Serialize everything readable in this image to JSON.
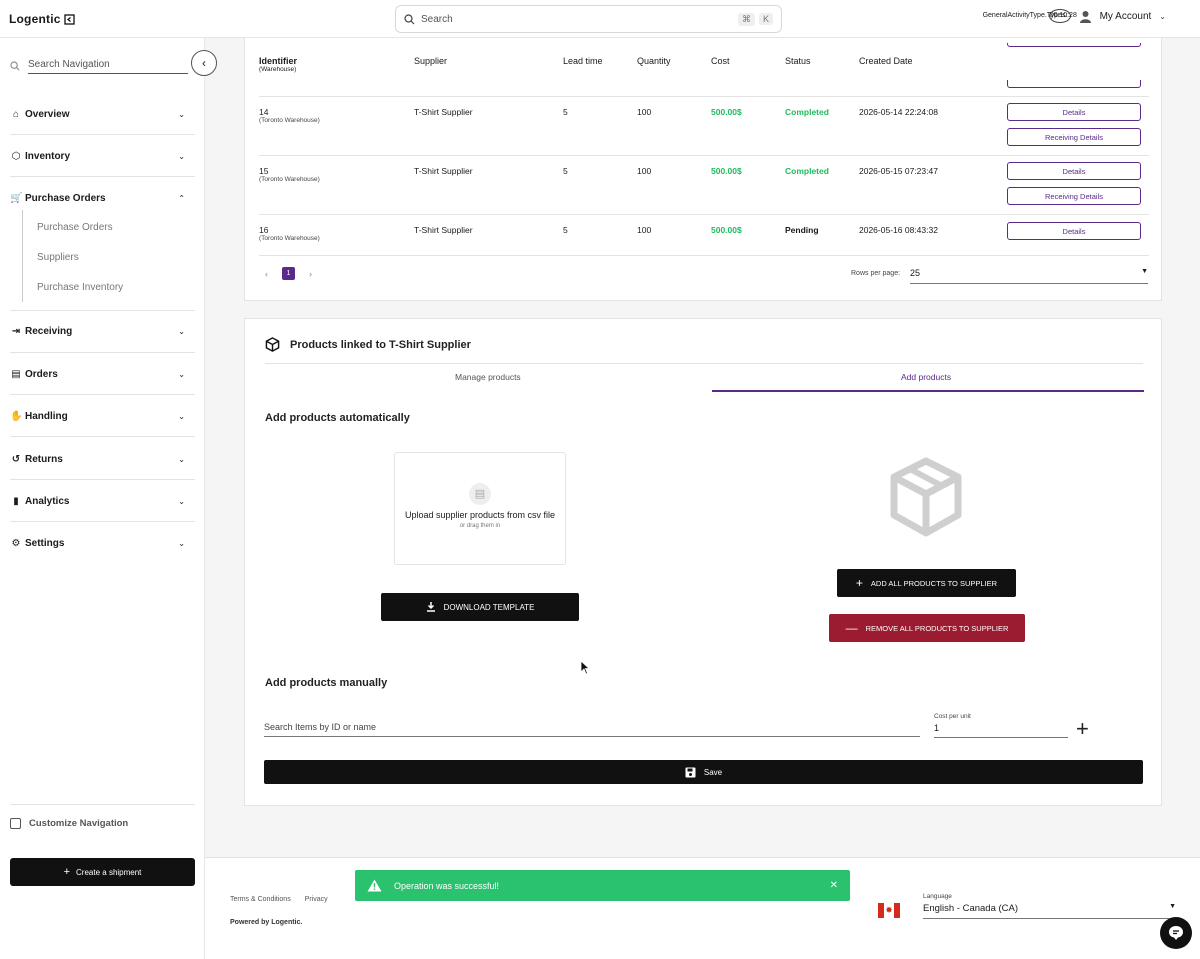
{
  "header": {
    "logo": "Logentic",
    "search_placeholder": "Search",
    "kbd_cmd": "⌘",
    "kbd_k": "K",
    "general_type": "GeneralActivityType.Types.",
    "timer": "00:10:28",
    "account": "My Account"
  },
  "sidebar": {
    "search_placeholder": "Search Navigation",
    "items": [
      {
        "label": "Overview"
      },
      {
        "label": "Inventory"
      },
      {
        "label": "Purchase Orders"
      },
      {
        "label": "Receiving"
      },
      {
        "label": "Orders"
      },
      {
        "label": "Handling"
      },
      {
        "label": "Returns"
      },
      {
        "label": "Analytics"
      },
      {
        "label": "Settings"
      }
    ],
    "subitems": [
      "Purchase Orders",
      "Suppliers",
      "Purchase Inventory"
    ],
    "customize": "Customize Navigation",
    "create_shipment": "Create a shipment"
  },
  "table": {
    "headers": {
      "identifier": "Identifier",
      "identifier_sub": "(Warehouse)",
      "supplier": "Supplier",
      "lead_time": "Lead time",
      "quantity": "Quantity",
      "cost": "Cost",
      "status": "Status",
      "created": "Created Date"
    },
    "rows": [
      {
        "id": "14",
        "warehouse": "(Toronto Warehouse)",
        "supplier": "T-Shirt Supplier",
        "lead": "5",
        "qty": "100",
        "cost": "500.00$",
        "status": "Completed",
        "created": "2026-05-14 22:24:08",
        "details": "Details",
        "receiving": "Receiving Details"
      },
      {
        "id": "15",
        "warehouse": "(Toronto Warehouse)",
        "supplier": "T-Shirt Supplier",
        "lead": "5",
        "qty": "100",
        "cost": "500.00$",
        "status": "Completed",
        "created": "2026-05-15 07:23:47",
        "details": "Details",
        "receiving": "Receiving Details"
      },
      {
        "id": "16",
        "warehouse": "(Toronto Warehouse)",
        "supplier": "T-Shirt Supplier",
        "lead": "5",
        "qty": "100",
        "cost": "500.00$",
        "status": "Pending",
        "created": "2026-05-16 08:43:32",
        "details": "Details"
      }
    ],
    "page": "1",
    "rows_per_page_label": "Rows per page:",
    "rows_per_page": "25"
  },
  "products": {
    "title": "Products linked to T-Shirt Supplier",
    "tabs": [
      "Manage products",
      "Add products"
    ],
    "auto_heading": "Add products automatically",
    "upload_text": "Upload supplier products from csv file",
    "upload_sub": "or drag them in",
    "download_template": "DOWNLOAD TEMPLATE",
    "add_all": "ADD ALL PRODUCTS TO SUPPLIER",
    "remove_all": "REMOVE ALL PRODUCTS TO SUPPLIER",
    "manual_heading": "Add products manually",
    "item_search_placeholder": "Search Items by ID or name",
    "cost_per_unit_label": "Cost per unit",
    "cost_per_unit": "1",
    "save": "Save"
  },
  "footer": {
    "terms": "Terms & Conditions",
    "privacy": "Privacy",
    "powered": "Powered by Logentic.",
    "language_label": "Language",
    "language": "English - Canada (CA)"
  },
  "toast": {
    "message": "Operation was successful!"
  },
  "colors": {
    "accent": "#5a2a8a",
    "success": "#2ac16f",
    "danger": "#9b1b30"
  }
}
